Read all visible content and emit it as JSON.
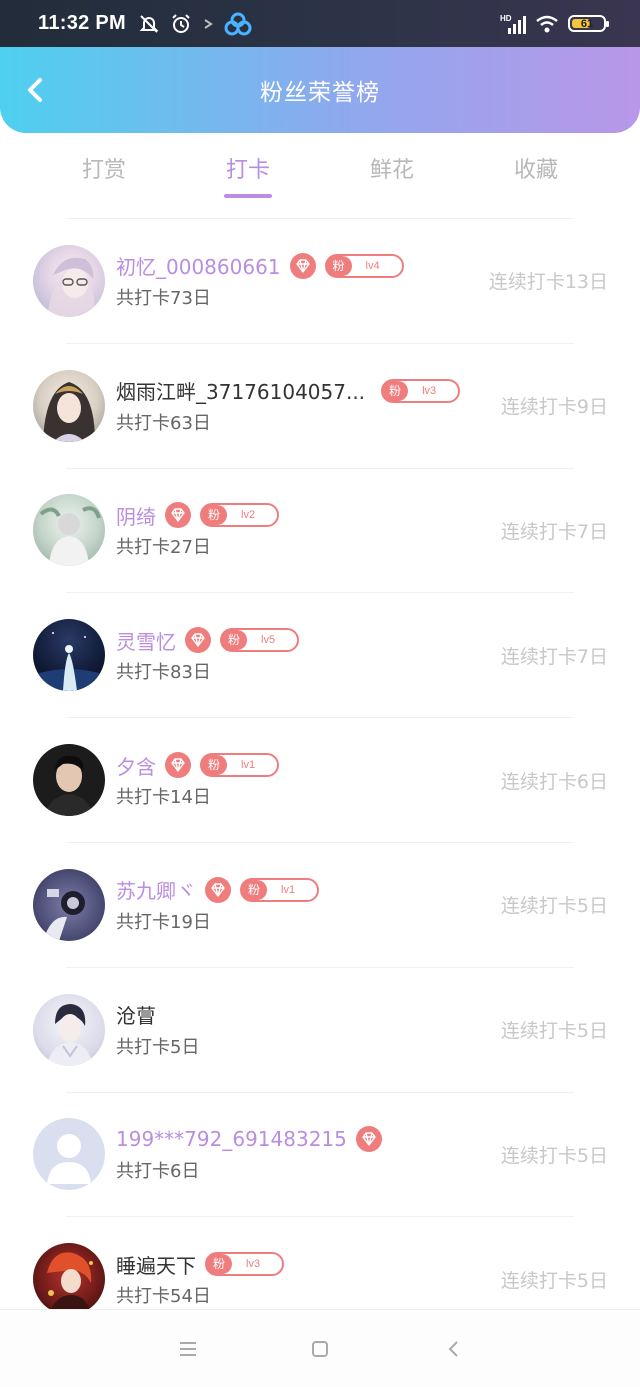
{
  "status_bar": {
    "time": "11:32 PM",
    "network": "HD",
    "battery": "61",
    "battery_level": 0.61
  },
  "header": {
    "title": "粉丝荣誉榜",
    "back_icon": "chevron-left-icon"
  },
  "tabs": [
    {
      "label": "打赏",
      "active": false
    },
    {
      "label": "打卡",
      "active": true
    },
    {
      "label": "鲜花",
      "active": false
    },
    {
      "label": "收藏",
      "active": false
    }
  ],
  "fan_badge_label": "粉",
  "colors": {
    "accent": "#b98ee2",
    "badge": "#ef7d7d",
    "header_start": "#4ed0ef",
    "header_end": "#b997e8"
  },
  "rows": [
    {
      "name": "初忆_000860661",
      "vip": true,
      "diamond": true,
      "level": "lv4",
      "total": "共打卡73日",
      "streak": "连续打卡13日"
    },
    {
      "name": "烟雨江畔_37176104057...",
      "vip": false,
      "diamond": false,
      "level": "lv3",
      "total": "共打卡63日",
      "streak": "连续打卡9日"
    },
    {
      "name": "阴绮",
      "vip": true,
      "diamond": true,
      "level": "lv2",
      "total": "共打卡27日",
      "streak": "连续打卡7日"
    },
    {
      "name": "灵雪忆",
      "vip": true,
      "diamond": true,
      "level": "lv5",
      "total": "共打卡83日",
      "streak": "连续打卡7日"
    },
    {
      "name": "夕含",
      "vip": true,
      "diamond": true,
      "level": "lv1",
      "total": "共打卡14日",
      "streak": "连续打卡6日"
    },
    {
      "name": "苏九卿ヾ",
      "vip": true,
      "diamond": true,
      "level": "lv1",
      "total": "共打卡19日",
      "streak": "连续打卡5日"
    },
    {
      "name": "沧萺",
      "vip": false,
      "diamond": false,
      "level": "",
      "total": "共打卡5日",
      "streak": "连续打卡5日"
    },
    {
      "name": "199***792_691483215",
      "vip": true,
      "diamond": true,
      "level": "",
      "total": "共打卡6日",
      "streak": "连续打卡5日"
    },
    {
      "name": "睡遍天下",
      "vip": false,
      "diamond": false,
      "level": "lv3",
      "total": "共打卡54日",
      "streak": "连续打卡5日"
    }
  ]
}
